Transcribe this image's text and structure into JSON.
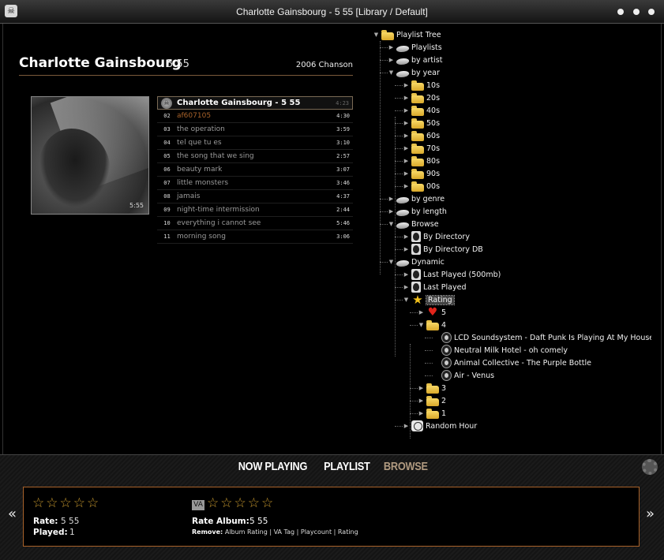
{
  "window": {
    "title": "Charlotte Gainsbourg - 5 55 [Library / Default]"
  },
  "album": {
    "artist": "Charlotte Gainsbourg",
    "title": "5 55",
    "meta": "2006 Chanson",
    "cover_text": "5:55"
  },
  "tracks": [
    {
      "no": "",
      "name": "Charlotte Gainsbourg - 5 55",
      "duration": "4:23",
      "playing": true
    },
    {
      "no": "02",
      "name": "af607105",
      "duration": "4:30",
      "highlight": true
    },
    {
      "no": "03",
      "name": "the operation",
      "duration": "3:59"
    },
    {
      "no": "04",
      "name": "tel que tu es",
      "duration": "3:10"
    },
    {
      "no": "05",
      "name": "the song that we sing",
      "duration": "2:57"
    },
    {
      "no": "06",
      "name": "beauty mark",
      "duration": "3:07"
    },
    {
      "no": "07",
      "name": "little monsters",
      "duration": "3:46"
    },
    {
      "no": "08",
      "name": "jamais",
      "duration": "4:37"
    },
    {
      "no": "09",
      "name": "night-time intermission",
      "duration": "2:44"
    },
    {
      "no": "10",
      "name": "everything i cannot see",
      "duration": "5:46"
    },
    {
      "no": "11",
      "name": "morning song",
      "duration": "3:06"
    }
  ],
  "tree": [
    {
      "label": "Playlist Tree",
      "icon": "folder",
      "level": 0,
      "expanded": true
    },
    {
      "label": "Playlists",
      "icon": "stack",
      "level": 1
    },
    {
      "label": "by artist",
      "icon": "stack",
      "level": 1
    },
    {
      "label": "by year",
      "icon": "stack",
      "level": 1,
      "expanded": true
    },
    {
      "label": "10s",
      "icon": "folder",
      "level": 2
    },
    {
      "label": "20s",
      "icon": "folder",
      "level": 2
    },
    {
      "label": "40s",
      "icon": "folder",
      "level": 2
    },
    {
      "label": "50s",
      "icon": "folder",
      "level": 2
    },
    {
      "label": "60s",
      "icon": "folder",
      "level": 2
    },
    {
      "label": "70s",
      "icon": "folder",
      "level": 2
    },
    {
      "label": "80s",
      "icon": "folder",
      "level": 2
    },
    {
      "label": "90s",
      "icon": "folder",
      "level": 2
    },
    {
      "label": "00s",
      "icon": "folder",
      "level": 2
    },
    {
      "label": "by genre",
      "icon": "stack",
      "level": 1
    },
    {
      "label": "by length",
      "icon": "stack",
      "level": 1
    },
    {
      "label": "Browse",
      "icon": "stack",
      "level": 1,
      "expanded": true
    },
    {
      "label": "By Directory",
      "icon": "alien",
      "level": 2
    },
    {
      "label": "By Directory DB",
      "icon": "alien",
      "level": 2
    },
    {
      "label": "Dynamic",
      "icon": "stack",
      "level": 1,
      "expanded": true
    },
    {
      "label": "Last Played (500mb)",
      "icon": "alien",
      "level": 2
    },
    {
      "label": "Last Played",
      "icon": "alien",
      "level": 2
    },
    {
      "label": "Rating",
      "icon": "star",
      "level": 2,
      "expanded": true,
      "selected": true
    },
    {
      "label": "5",
      "icon": "heart",
      "level": 3
    },
    {
      "label": "4",
      "icon": "folder",
      "level": 3,
      "expanded": true
    },
    {
      "label": "LCD Soundsystem - Daft Punk Is Playing At My House (S",
      "icon": "alien-sm",
      "level": 4,
      "leaf": true
    },
    {
      "label": "Neutral Milk Hotel - oh comely",
      "icon": "alien-sm",
      "level": 4,
      "leaf": true
    },
    {
      "label": "Animal Collective - The Purple Bottle",
      "icon": "alien-sm",
      "level": 4,
      "leaf": true
    },
    {
      "label": "Air - Venus",
      "icon": "alien-sm",
      "level": 4,
      "leaf": true
    },
    {
      "label": "3",
      "icon": "folder",
      "level": 3
    },
    {
      "label": "2",
      "icon": "folder",
      "level": 3
    },
    {
      "label": "1",
      "icon": "folder",
      "level": 3
    },
    {
      "label": "Random Hour",
      "icon": "clock",
      "level": 2
    }
  ],
  "tabs": [
    {
      "label": "NOW PLAYING",
      "active": false
    },
    {
      "label": "PLAYLIST",
      "active": false
    },
    {
      "label": "BROWSE",
      "active": true
    }
  ],
  "rating": {
    "rate_label": "Rate:",
    "rate_value": "5 55",
    "played_label": "Played:",
    "played_value": "1",
    "va_badge": "VA",
    "rate_album_label": "Rate Album:",
    "rate_album_value": "5 55",
    "remove_label": "Remove:",
    "remove_options": "Album Rating | VA Tag | Playcount | Rating",
    "stars": "☆☆☆☆☆"
  },
  "nav": {
    "prev": "«",
    "next": "»"
  },
  "colors": {
    "accent": "#a8622a",
    "folder": "#f2c94c",
    "background": "#000000"
  }
}
